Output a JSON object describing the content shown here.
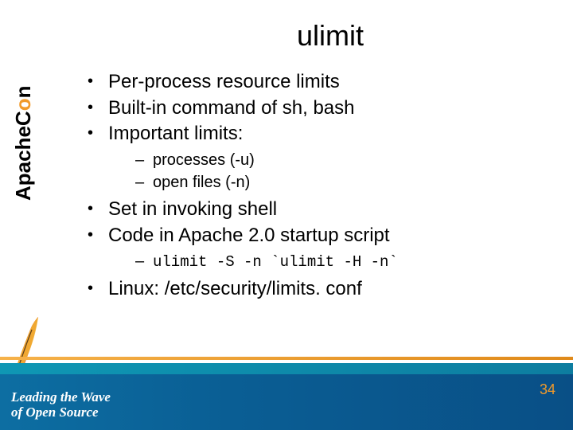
{
  "brand": {
    "text_plain": "ApacheC",
    "accent": "o",
    "text_tail": "n"
  },
  "title": "ulimit",
  "bullets": [
    "Per-process resource limits",
    "Built-in command of sh, bash",
    "Important limits:"
  ],
  "sub1": [
    " processes (-u)",
    "open files (-n)"
  ],
  "bullets2": [
    "Set in invoking shell",
    "Code in Apache 2.0 startup script"
  ],
  "sub2_code": "ulimit -S -n `ulimit -H -n`",
  "bullets3": "Linux: /etc/security/limits. conf",
  "footer": {
    "tagline1": "Leading the Wave",
    "tagline2": "of Open Source",
    "page": "34"
  }
}
